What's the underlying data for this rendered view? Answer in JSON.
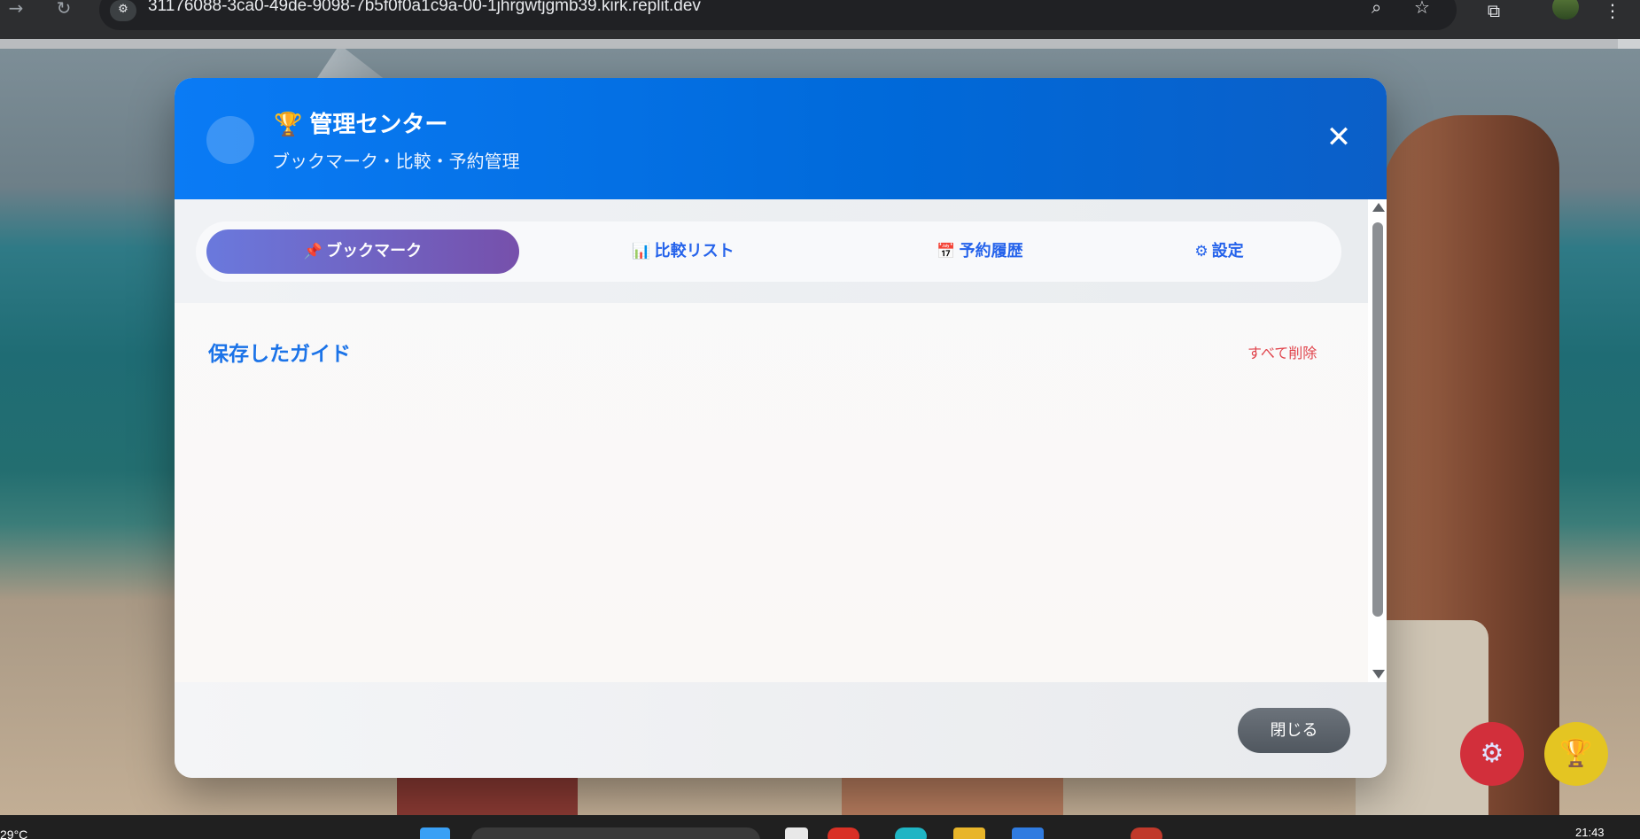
{
  "browser": {
    "back_icon": "→",
    "reload_icon": "↻",
    "site_info_icon": "⚙",
    "url": "31176088-3ca0-49de-9098-7b5f0f0a1c9a-00-1jhrgwtjgmb39.kirk.replit.dev",
    "zoom_icon": "⌕",
    "star_icon": "☆",
    "extensions_icon": "⧉",
    "menu_icon": "⋮"
  },
  "modal": {
    "title_icon": "🏆",
    "title": "管理センター",
    "subtitle": "ブックマーク・比較・予約管理",
    "close_icon": "✕",
    "tabs": [
      {
        "icon": "📌",
        "label": "ブックマーク",
        "active": true
      },
      {
        "icon": "📊",
        "label": "比較リスト",
        "active": false
      },
      {
        "icon": "📅",
        "label": "予約履歴",
        "active": false
      },
      {
        "icon": "⚙",
        "label": "設定",
        "active": false
      }
    ],
    "section_title": "保存したガイド",
    "delete_all": "すべて削除",
    "footer_close": "閉じる"
  },
  "fabs": {
    "settings_icon": "⚙",
    "trophy_icon": "🏆"
  },
  "taskbar": {
    "weather": "29°C",
    "time": "21:43"
  },
  "colors": {
    "header_blue": "#0a7bf5",
    "active_tab_start": "#6a79dd",
    "active_tab_end": "#7650ab",
    "tab_text": "#2563eb",
    "delete_red": "#e0424a",
    "fab_red": "#d22f3b",
    "fab_yellow": "#e4c522"
  }
}
